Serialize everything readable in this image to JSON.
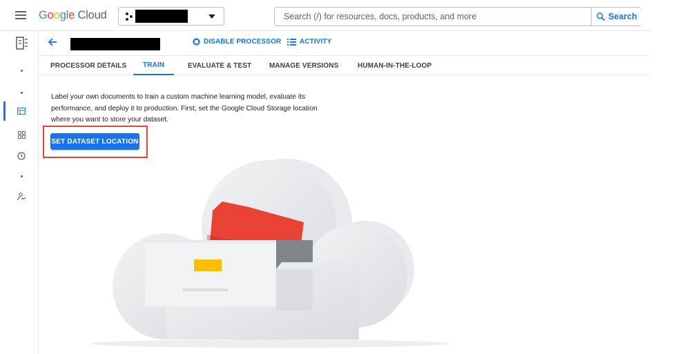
{
  "topbar": {
    "logo_word": [
      "G",
      "o",
      "o",
      "g",
      "l",
      "e"
    ],
    "logo_product": "Cloud",
    "search": {
      "placeholder": "Search (/) for resources, docs, products, and more",
      "button_label": "Search"
    }
  },
  "header": {
    "disable_label": "DISABLE PROCESSOR",
    "activity_label": "ACTIVITY"
  },
  "tabs": [
    {
      "label": "PROCESSOR DETAILS",
      "active": false
    },
    {
      "label": "TRAIN",
      "active": true
    },
    {
      "label": "EVALUATE & TEST",
      "active": false
    },
    {
      "label": "MANAGE VERSIONS",
      "active": false
    },
    {
      "label": "HUMAN-IN-THE-LOOP",
      "active": false
    }
  ],
  "main": {
    "description": "Label your own documents to train a custom machine learning model, evaluate its performance, and deploy it to production. First, set the Google Cloud Storage location where you want to store your dataset.",
    "set_location_label": "SET DATASET LOCATION"
  },
  "colors": {
    "accent": "#1a73e8",
    "highlight": "#ea4335",
    "folder": "#ea4335",
    "tag": "#fbbc05"
  },
  "icons": [
    "menu-icon",
    "project-icon",
    "search-icon",
    "back-arrow-icon",
    "disable-icon",
    "activity-list-icon",
    "document-ai-icon",
    "dashboard-icon",
    "grid-icon",
    "history-icon",
    "signature-icon"
  ]
}
